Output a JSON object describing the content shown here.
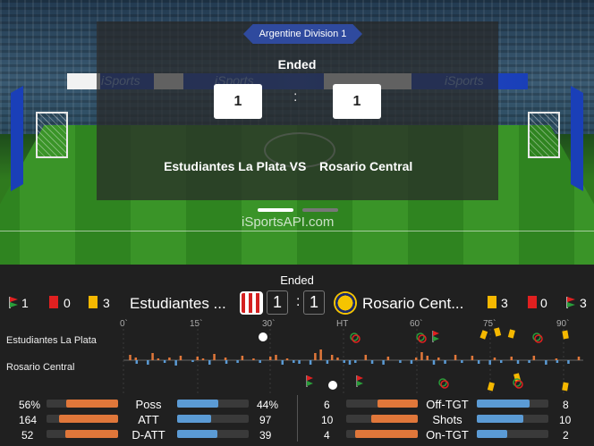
{
  "hero": {
    "league": "Argentine Division 1",
    "status": "Ended",
    "home_score": "1",
    "away_score": "1",
    "colon": ":",
    "home_team": "Estudiantes La Plata",
    "vs": "VS",
    "away_team": "Rosario Central",
    "watermark": "iSportsAPI.com",
    "ad_text": "iSports"
  },
  "panel": {
    "status": "Ended",
    "home": {
      "corners": "1",
      "red_cards": "0",
      "yellow_cards": "3",
      "name": "Estudiantes ...",
      "score": "1"
    },
    "away": {
      "name": "Rosario Cent...",
      "score": "1",
      "yellow_cards": "3",
      "red_cards": "0",
      "corners": "3"
    },
    "colon": ":"
  },
  "timeline": {
    "ticks": [
      "0`",
      "15`",
      "30`",
      "HT",
      "60`",
      "75`",
      "90`"
    ],
    "home_label": "Estudiantes La Plata",
    "away_label": "Rosario Central"
  },
  "stats_left": [
    {
      "home": "56%",
      "label": "Poss",
      "away": "44%",
      "home_frac": 0.56,
      "away_frac": 0.44
    },
    {
      "home": "164",
      "label": "ATT",
      "away": "97",
      "home_frac": 0.63,
      "away_frac": 0.37
    },
    {
      "home": "52",
      "label": "D-ATT",
      "away": "39",
      "home_frac": 0.57,
      "away_frac": 0.43
    }
  ],
  "stats_right": [
    {
      "home": "6",
      "label": "Off-TGT",
      "away": "8",
      "home_frac": 0.43,
      "away_frac": 0.57
    },
    {
      "home": "10",
      "label": "Shots",
      "away": "10",
      "home_frac": 0.5,
      "away_frac": 0.5
    },
    {
      "home": "4",
      "label": "On-TGT",
      "away": "2",
      "home_frac": 0.67,
      "away_frac": 0.33
    }
  ],
  "colors": {
    "home_bar": "#e0773a",
    "away_bar": "#5b9bd5",
    "red_card": "#e02020",
    "yellow_card": "#f5b800",
    "league_bg": "#2f4a9e"
  }
}
